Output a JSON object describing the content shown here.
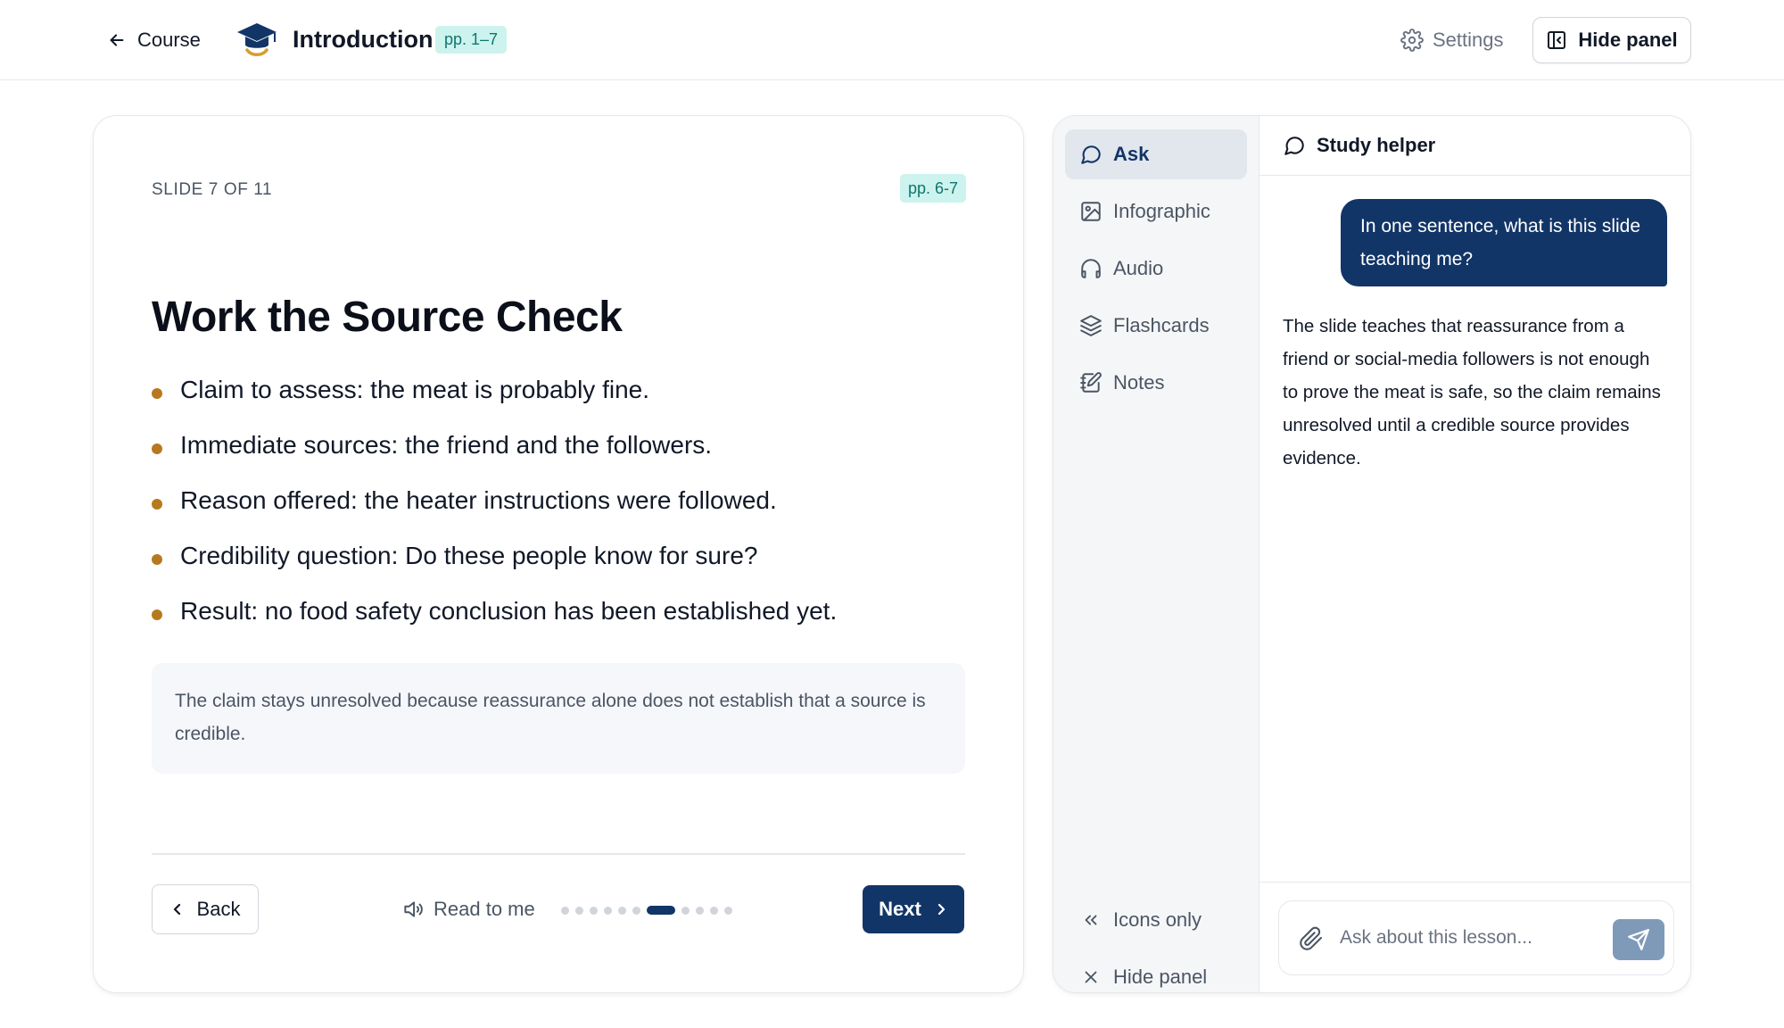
{
  "header": {
    "back_label": "Course",
    "course_title": "Introduction",
    "pages_badge": "pp. 1–7",
    "settings_label": "Settings",
    "hide_panel_label": "Hide panel"
  },
  "slide": {
    "counter": "SLIDE 7 OF 11",
    "pages": "pp. 6-7",
    "title": "Work the Source Check",
    "bullets": [
      "Claim to assess: the meat is probably fine.",
      "Immediate sources: the friend and the followers.",
      "Reason offered: the heater instructions were followed.",
      "Credibility question: Do these people know for sure?",
      "Result: no food safety conclusion has been established yet."
    ],
    "callout": "The claim stays unresolved because reassurance alone does not establish that a source is credible.",
    "back_label": "Back",
    "read_label": "Read to me",
    "next_label": "Next",
    "progress": {
      "current": 7,
      "total": 11
    }
  },
  "panel": {
    "nav": [
      {
        "label": "Ask",
        "icon": "chat-bubble-icon",
        "active": true
      },
      {
        "label": "Infographic",
        "icon": "image-icon",
        "active": false
      },
      {
        "label": "Audio",
        "icon": "headphones-icon",
        "active": false
      },
      {
        "label": "Flashcards",
        "icon": "layers-icon",
        "active": false
      },
      {
        "label": "Notes",
        "icon": "notebook-icon",
        "active": false
      }
    ],
    "icons_only_label": "Icons only",
    "hide_panel_label": "Hide panel",
    "chat": {
      "title": "Study helper",
      "user_message": "In one sentence, what is this slide teaching me?",
      "assistant_message": "The slide teaches that reassurance from a friend or social-media followers is not enough to prove the meat is safe, so the claim remains unresolved until a credible source provides evidence.",
      "input_placeholder": "Ask about this lesson..."
    }
  },
  "colors": {
    "primary": "#123567",
    "bullet": "#b7791f",
    "badge_bg": "#ccf3ee",
    "badge_text": "#0f766e",
    "send_button": "#7f9ab9"
  }
}
